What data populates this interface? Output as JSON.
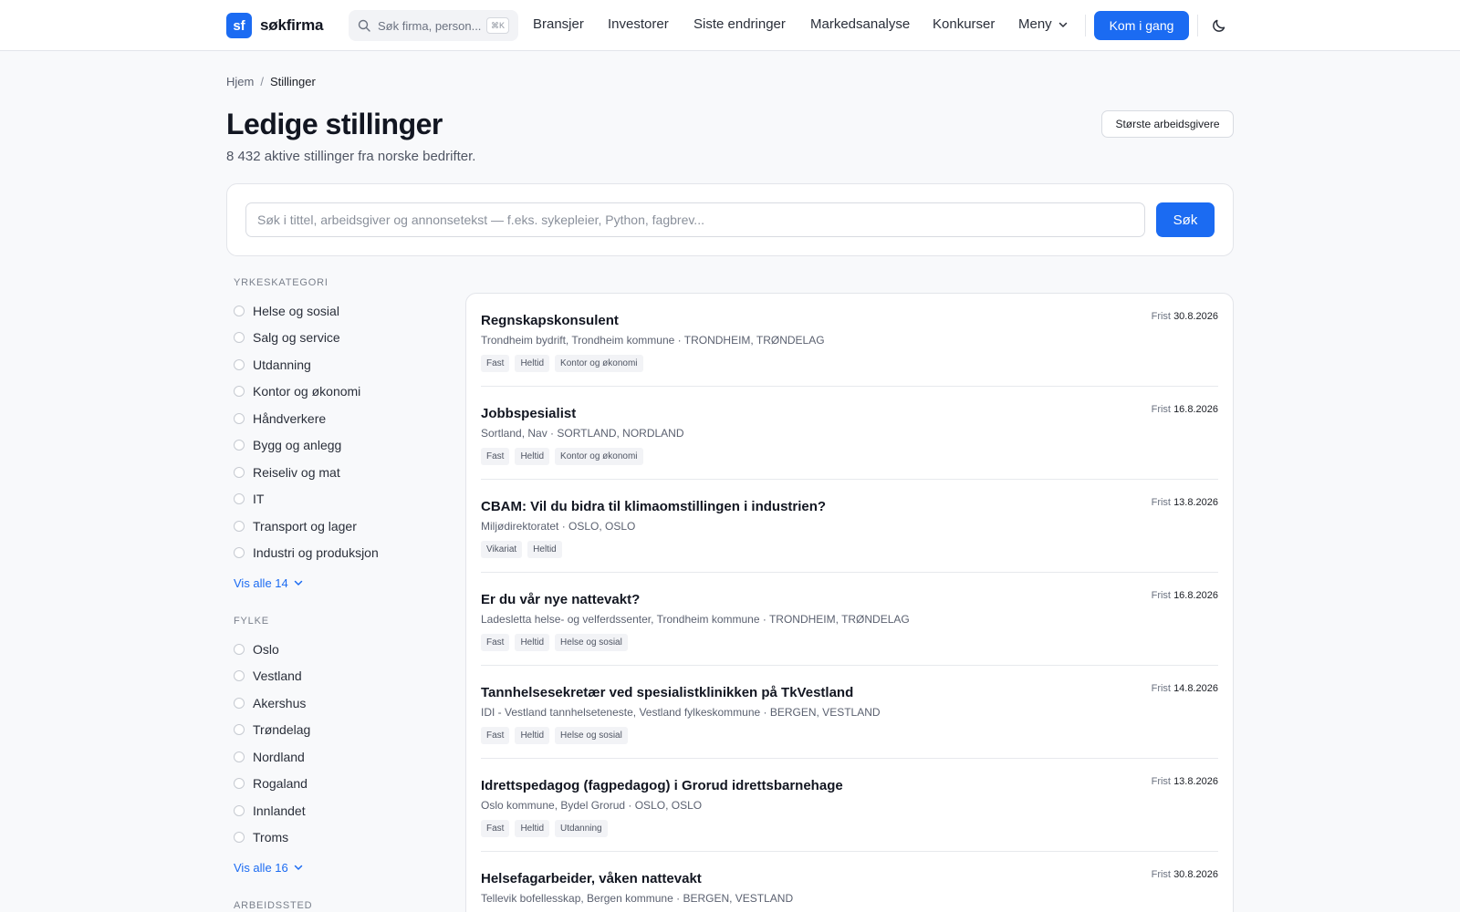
{
  "brand": {
    "logo_mark": "sf",
    "name": "søkfirma"
  },
  "nav": {
    "search_placeholder": "Søk firma, person...",
    "shortcut": "⌘K",
    "links": [
      "Bransjer",
      "Investorer",
      "Siste endringer",
      "Markedsanalyse",
      "Konkurser"
    ],
    "menu_label": "Meny",
    "cta_label": "Kom i gang",
    "theme_icon": "moon-icon"
  },
  "breadcrumb": {
    "home": "Hjem",
    "separator": "/",
    "current": "Stillinger"
  },
  "header": {
    "title": "Ledige stillinger",
    "subtitle": "8 432 aktive stillinger fra norske bedrifter.",
    "employers_button": "Største arbeidsgivere"
  },
  "search": {
    "placeholder": "Søk i tittel, arbeidsgiver og annonsetekst — f.eks. sykepleier, Python, fagbrev...",
    "value": "",
    "button": "Søk"
  },
  "filters": [
    {
      "heading": "Yrkeskategori",
      "options": [
        "Helse og sosial",
        "Salg og service",
        "Utdanning",
        "Kontor og økonomi",
        "Håndverkere",
        "Bygg og anlegg",
        "Reiseliv og mat",
        "IT",
        "Transport og lager",
        "Industri og produksjon"
      ],
      "show_all": "Vis alle 14"
    },
    {
      "heading": "Fylke",
      "options": [
        "Oslo",
        "Vestland",
        "Akershus",
        "Trøndelag",
        "Nordland",
        "Rogaland",
        "Innlandet",
        "Troms"
      ],
      "show_all": "Vis alle 16"
    },
    {
      "heading": "Arbeidssted",
      "options": [],
      "show_all": ""
    }
  ],
  "jobs": [
    {
      "title": "Regnskapskonsulent",
      "meta": "Trondheim bydrift, Trondheim kommune · TRONDHEIM, TRØNDELAG",
      "tags": [
        "Fast",
        "Heltid",
        "Kontor og økonomi"
      ],
      "deadline_label": "Frist",
      "deadline": "30.8.2026"
    },
    {
      "title": "Jobbspesialist",
      "meta": "Sortland, Nav · SORTLAND, NORDLAND",
      "tags": [
        "Fast",
        "Heltid",
        "Kontor og økonomi"
      ],
      "deadline_label": "Frist",
      "deadline": "16.8.2026"
    },
    {
      "title": "CBAM: Vil du bidra til klimaomstillingen i industrien?",
      "meta": "Miljødirektoratet · OSLO, OSLO",
      "tags": [
        "Vikariat",
        "Heltid"
      ],
      "deadline_label": "Frist",
      "deadline": "13.8.2026"
    },
    {
      "title": "Er du vår nye nattevakt?",
      "meta": "Ladesletta helse- og velferdssenter, Trondheim kommune · TRONDHEIM, TRØNDELAG",
      "tags": [
        "Fast",
        "Heltid",
        "Helse og sosial"
      ],
      "deadline_label": "Frist",
      "deadline": "16.8.2026"
    },
    {
      "title": "Tannhelsesekretær ved spesialistklinikken på TkVestland",
      "meta": "IDI - Vestland tannhelseteneste, Vestland fylkeskommune · BERGEN, VESTLAND",
      "tags": [
        "Fast",
        "Heltid",
        "Helse og sosial"
      ],
      "deadline_label": "Frist",
      "deadline": "14.8.2026"
    },
    {
      "title": "Idrettspedagog (fagpedagog) i Grorud idrettsbarnehage",
      "meta": "Oslo kommune, Bydel Grorud · OSLO, OSLO",
      "tags": [
        "Fast",
        "Heltid",
        "Utdanning"
      ],
      "deadline_label": "Frist",
      "deadline": "13.8.2026"
    },
    {
      "title": "Helsefagarbeider, våken nattevakt",
      "meta": "Tellevik bofellesskap, Bergen kommune · BERGEN, VESTLAND",
      "tags": [],
      "deadline_label": "Frist",
      "deadline": "30.8.2026"
    }
  ],
  "colors": {
    "accent": "#1b6bf2",
    "text": "#121621",
    "muted": "#5b6170",
    "background": "#f8f9fb"
  }
}
